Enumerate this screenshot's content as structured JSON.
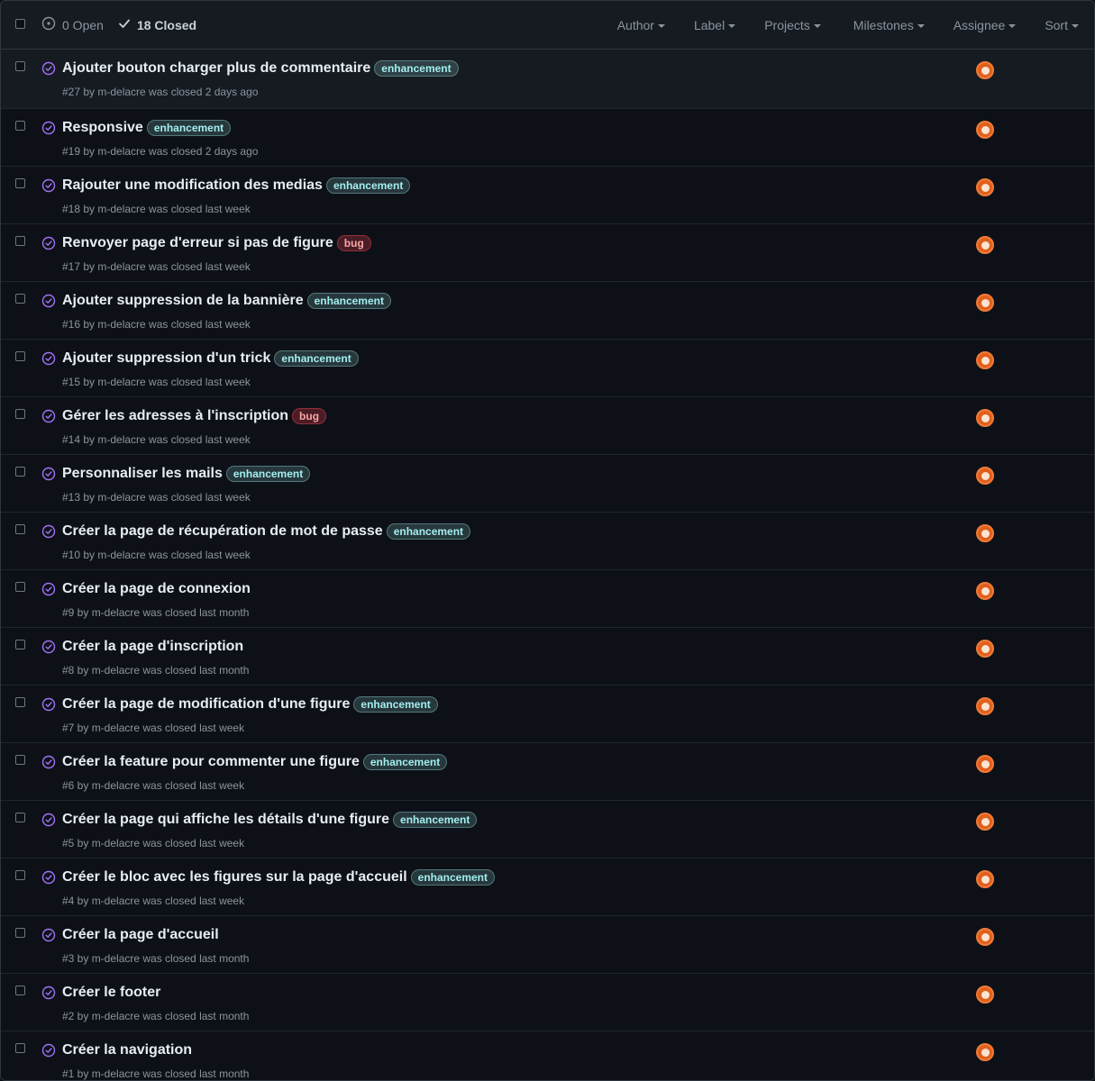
{
  "header": {
    "open_label": "0 Open",
    "closed_label": "18 Closed",
    "filters": [
      {
        "label": "Author",
        "icon": "caret-down-icon"
      },
      {
        "label": "Label",
        "icon": "caret-down-icon"
      },
      {
        "label": "Projects",
        "icon": "caret-down-icon"
      },
      {
        "label": "Milestones",
        "icon": "caret-down-icon"
      },
      {
        "label": "Assignee",
        "icon": "caret-down-icon"
      },
      {
        "label": "Sort",
        "icon": "caret-down-icon"
      }
    ]
  },
  "colors": {
    "closed_icon": "#a371f7",
    "enhancement": "#a2eeef",
    "bug": "#d73a4a",
    "avatar": "#e0601b"
  },
  "issues": [
    {
      "title": "Ajouter bouton charger plus de commentaire",
      "label": "enhancement",
      "meta": "#27 by m-delacre was closed 2 days ago"
    },
    {
      "title": "Responsive",
      "label": "enhancement",
      "meta": "#19 by m-delacre was closed 2 days ago"
    },
    {
      "title": "Rajouter une modification des medias",
      "label": "enhancement",
      "meta": "#18 by m-delacre was closed last week"
    },
    {
      "title": "Renvoyer page d'erreur si pas de figure",
      "label": "bug",
      "meta": "#17 by m-delacre was closed last week"
    },
    {
      "title": "Ajouter suppression de la bannière",
      "label": "enhancement",
      "meta": "#16 by m-delacre was closed last week"
    },
    {
      "title": "Ajouter suppression d'un trick",
      "label": "enhancement",
      "meta": "#15 by m-delacre was closed last week"
    },
    {
      "title": "Gérer les adresses à l'inscription",
      "label": "bug",
      "meta": "#14 by m-delacre was closed last week"
    },
    {
      "title": "Personnaliser les mails",
      "label": "enhancement",
      "meta": "#13 by m-delacre was closed last week"
    },
    {
      "title": "Créer la page de récupération de mot de passe",
      "label": "enhancement",
      "meta": "#10 by m-delacre was closed last week"
    },
    {
      "title": "Créer la page de connexion",
      "label": "",
      "meta": "#9 by m-delacre was closed last month"
    },
    {
      "title": "Créer la page d'inscription",
      "label": "",
      "meta": "#8 by m-delacre was closed last month"
    },
    {
      "title": "Créer la page de modification d'une figure",
      "label": "enhancement",
      "meta": "#7 by m-delacre was closed last week"
    },
    {
      "title": "Créer la feature pour commenter une figure",
      "label": "enhancement",
      "meta": "#6 by m-delacre was closed last week"
    },
    {
      "title": "Créer la page qui affiche les détails d'une figure",
      "label": "enhancement",
      "meta": "#5 by m-delacre was closed last week"
    },
    {
      "title": "Créer le bloc avec les figures sur la page d'accueil",
      "label": "enhancement",
      "meta": "#4 by m-delacre was closed last week"
    },
    {
      "title": "Créer la page d'accueil",
      "label": "",
      "meta": "#3 by m-delacre was closed last month"
    },
    {
      "title": "Créer le footer",
      "label": "",
      "meta": "#2 by m-delacre was closed last month"
    },
    {
      "title": "Créer la navigation",
      "label": "",
      "meta": "#1 by m-delacre was closed last month"
    }
  ]
}
